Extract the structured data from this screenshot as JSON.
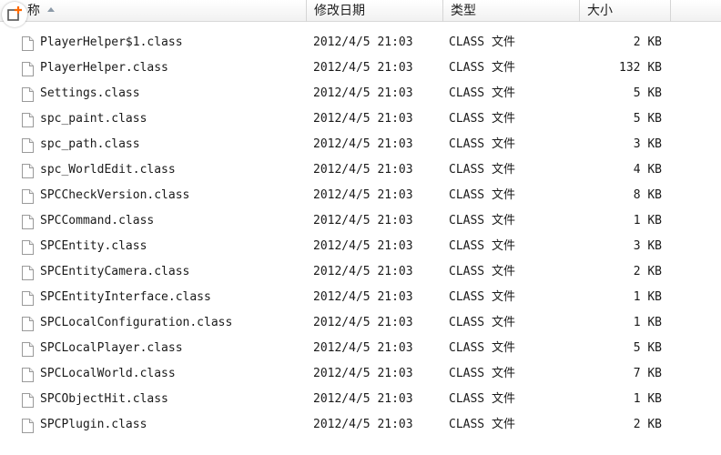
{
  "columns": {
    "name": "称",
    "date": "修改日期",
    "type": "类型",
    "size": "大小"
  },
  "icons": {
    "overlay": "add-overlay-icon",
    "file": "file-icon",
    "overlay_accent": "#ff6a00"
  },
  "files": [
    {
      "name": "PlayerHelper$1.class",
      "date": "2012/4/5 21:03",
      "type": "CLASS 文件",
      "size": "2 KB"
    },
    {
      "name": "PlayerHelper.class",
      "date": "2012/4/5 21:03",
      "type": "CLASS 文件",
      "size": "132 KB"
    },
    {
      "name": "Settings.class",
      "date": "2012/4/5 21:03",
      "type": "CLASS 文件",
      "size": "5 KB"
    },
    {
      "name": "spc_paint.class",
      "date": "2012/4/5 21:03",
      "type": "CLASS 文件",
      "size": "5 KB"
    },
    {
      "name": "spc_path.class",
      "date": "2012/4/5 21:03",
      "type": "CLASS 文件",
      "size": "3 KB"
    },
    {
      "name": "spc_WorldEdit.class",
      "date": "2012/4/5 21:03",
      "type": "CLASS 文件",
      "size": "4 KB"
    },
    {
      "name": "SPCCheckVersion.class",
      "date": "2012/4/5 21:03",
      "type": "CLASS 文件",
      "size": "8 KB"
    },
    {
      "name": "SPCCommand.class",
      "date": "2012/4/5 21:03",
      "type": "CLASS 文件",
      "size": "1 KB"
    },
    {
      "name": "SPCEntity.class",
      "date": "2012/4/5 21:03",
      "type": "CLASS 文件",
      "size": "3 KB"
    },
    {
      "name": "SPCEntityCamera.class",
      "date": "2012/4/5 21:03",
      "type": "CLASS 文件",
      "size": "2 KB"
    },
    {
      "name": "SPCEntityInterface.class",
      "date": "2012/4/5 21:03",
      "type": "CLASS 文件",
      "size": "1 KB"
    },
    {
      "name": "SPCLocalConfiguration.class",
      "date": "2012/4/5 21:03",
      "type": "CLASS 文件",
      "size": "1 KB"
    },
    {
      "name": "SPCLocalPlayer.class",
      "date": "2012/4/5 21:03",
      "type": "CLASS 文件",
      "size": "5 KB"
    },
    {
      "name": "SPCLocalWorld.class",
      "date": "2012/4/5 21:03",
      "type": "CLASS 文件",
      "size": "7 KB"
    },
    {
      "name": "SPCObjectHit.class",
      "date": "2012/4/5 21:03",
      "type": "CLASS 文件",
      "size": "1 KB"
    },
    {
      "name": "SPCPlugin.class",
      "date": "2012/4/5 21:03",
      "type": "CLASS 文件",
      "size": "2 KB"
    }
  ]
}
